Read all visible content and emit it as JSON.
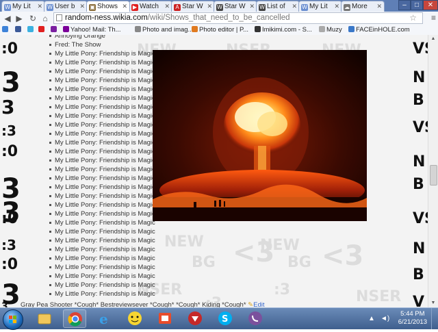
{
  "tabs": [
    {
      "label": "My Lit",
      "color": "#6b8fd1",
      "glyph": "W"
    },
    {
      "label": "User b",
      "color": "#6b8fd1",
      "glyph": "W"
    },
    {
      "label": "Shows",
      "color": "#8a6d3b",
      "glyph": "▣",
      "active": true
    },
    {
      "label": "Watch",
      "color": "#e02020",
      "glyph": "▶"
    },
    {
      "label": "Star W",
      "color": "#cc2222",
      "glyph": "A"
    },
    {
      "label": "Star W",
      "color": "#444",
      "glyph": "W"
    },
    {
      "label": "List of",
      "color": "#444",
      "glyph": "W"
    },
    {
      "label": "My Lit",
      "color": "#6b8fd1",
      "glyph": "W"
    },
    {
      "label": "More",
      "color": "#777",
      "glyph": "☁"
    }
  ],
  "url": {
    "host": "random-ness.wikia.com",
    "path": "/wiki/Shows_that_need_to_be_cancelled"
  },
  "bookmarks": [
    {
      "label": "",
      "color": "#3d82d8"
    },
    {
      "label": "",
      "color": "#3b5998"
    },
    {
      "label": "",
      "color": "#3bb1e0"
    },
    {
      "label": "",
      "color": "#e02020"
    },
    {
      "label": "",
      "color": "#7a1fa0"
    },
    {
      "label": "Yahoo! Mail: Th...",
      "color": "#7b0099"
    },
    {
      "label": "Photo and imag...",
      "color": "#888"
    },
    {
      "label": "Photo editor | P...",
      "color": "#e07a20"
    },
    {
      "label": "Imikimi.com - S...",
      "color": "#333"
    },
    {
      "label": "Muzy",
      "color": "#aaa"
    },
    {
      "label": "FACEinHOLE.com",
      "color": "#3a78c8"
    }
  ],
  "list": {
    "first": "Annoying Orange",
    "second": "Fred: The Show",
    "repeated": "My Little Pony: Friendship is Magic",
    "repeat_count": 28
  },
  "footer": {
    "text": "Gray Pea Shooter *Cough* Bestreviewsever *Cough* *Cough* Kiding *Cough*",
    "edit": "Edit"
  },
  "doodles": [
    ":0",
    "3",
    "3",
    ":3",
    ":0",
    "3",
    "3",
    ":0",
    ":3",
    ":0",
    "3",
    "3",
    ":3",
    ":0",
    "3",
    "3",
    ":3",
    ":0"
  ],
  "right_doodles": [
    "VS",
    "N",
    "B",
    "VS",
    "N",
    "B",
    "VS",
    "N",
    "B",
    "V"
  ],
  "background_words": [
    "NEW",
    "BG",
    "<3",
    ":3",
    "NSER"
  ],
  "taskbar": {
    "clock_time": "5:44 PM",
    "clock_date": "6/21/2013"
  },
  "colors": {
    "tabstrip": "#5f7fb6",
    "taskbar": "#4a6a98"
  }
}
